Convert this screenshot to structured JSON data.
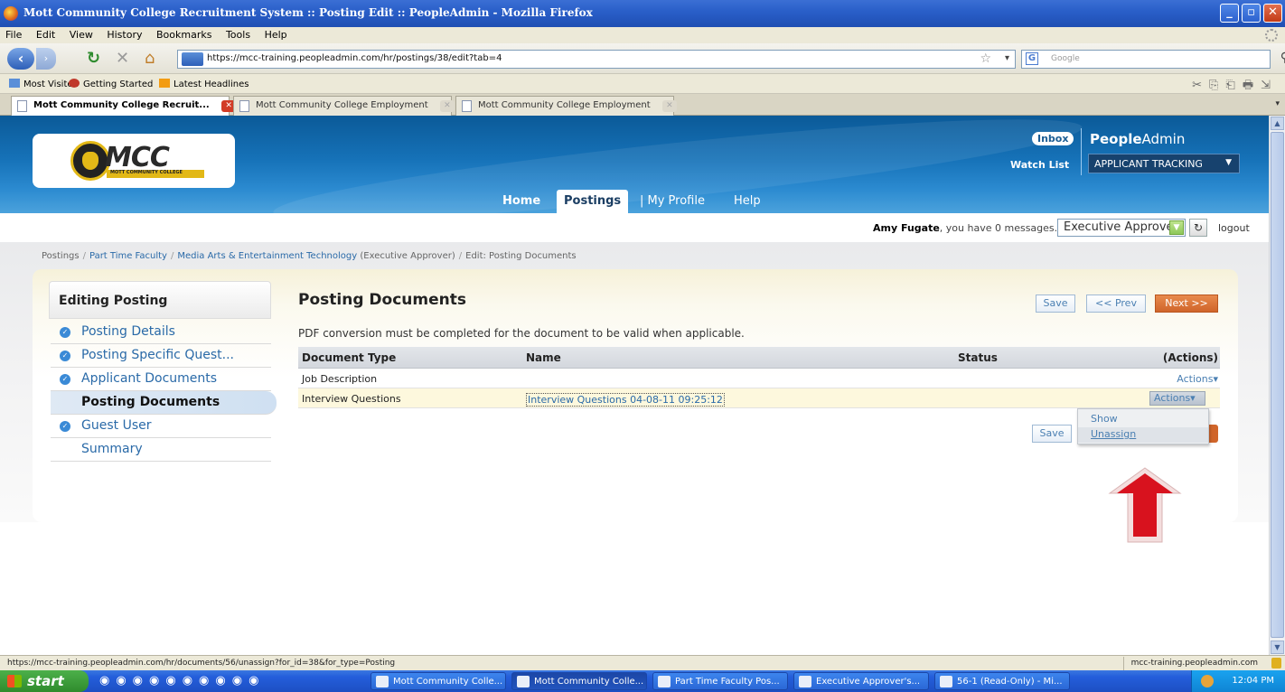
{
  "window": {
    "title": "Mott Community College Recruitment System :: Posting Edit :: PeopleAdmin - Mozilla Firefox",
    "minimize": "_",
    "maximize": "▫",
    "close": "✕"
  },
  "menu": [
    "File",
    "Edit",
    "View",
    "History",
    "Bookmarks",
    "Tools",
    "Help"
  ],
  "toolbar": {
    "url": "https://mcc-training.peopleadmin.com/hr/postings/38/edit?tab=4",
    "search_placeholder": "Google"
  },
  "bookmarks": [
    "Most Visited",
    "Getting Started",
    "Latest Headlines"
  ],
  "tabs": [
    {
      "label": "Mott Community College Recruit...",
      "active": true
    },
    {
      "label": "Mott Community College Employment",
      "active": false
    },
    {
      "label": "Mott Community College Employment",
      "active": false
    }
  ],
  "header": {
    "logo_text": "MCC",
    "logo_subtext": "MOTT COMMUNITY COLLEGE",
    "inbox": "Inbox",
    "watch_list": "Watch List",
    "brand_bold": "People",
    "brand_light": "Admin",
    "module": "APPLICANT TRACKING",
    "nav": [
      "Home",
      "Postings",
      "| My Profile",
      "Help"
    ]
  },
  "user": {
    "name": "Amy Fugate",
    "message": ", you have 0 messages.",
    "role": "Executive Approver",
    "logout": "logout"
  },
  "breadcrumb": {
    "root": "Postings",
    "item1": "Part Time Faculty",
    "item2": "Media Arts & Entertainment Technology",
    "role_note": "(Executive Approver)",
    "current": "Edit: Posting Documents"
  },
  "sidebar": {
    "title": "Editing Posting",
    "items": [
      {
        "label": "Posting Details",
        "check": true
      },
      {
        "label": "Posting Specific Quest...",
        "check": true
      },
      {
        "label": "Applicant Documents",
        "check": true
      },
      {
        "label": "Posting Documents",
        "check": false,
        "active": true
      },
      {
        "label": "Guest User",
        "check": true
      },
      {
        "label": "Summary",
        "check": false
      }
    ]
  },
  "main": {
    "title": "Posting Documents",
    "save": "Save",
    "prev": "<< Prev",
    "next": "Next >>",
    "notice": "PDF conversion must be completed for the document to be valid when applicable.",
    "columns": [
      "Document Type",
      "Name",
      "Status",
      "(Actions)"
    ],
    "rows": [
      {
        "type": "Job Description",
        "name": "",
        "status": "",
        "action": "Actions▾"
      },
      {
        "type": "Interview Questions",
        "name": "Interview Questions 04-08-11 09:25:12",
        "status": "",
        "action": "Actions▾"
      }
    ],
    "save_bottom": "Save",
    "dropdown": [
      "Show",
      "Unassign"
    ]
  },
  "status_bar": {
    "url": "https://mcc-training.peopleadmin.com/hr/documents/56/unassign?for_id=38&for_type=Posting",
    "host": "mcc-training.peopleadmin.com"
  },
  "taskbar": {
    "start": "start",
    "items": [
      "Mott Community Colle...",
      "Mott Community Colle...",
      "Part Time Faculty Pos...",
      "Executive Approver's...",
      "56-1 (Read-Only) - Mi..."
    ],
    "clock": "12:04 PM"
  }
}
